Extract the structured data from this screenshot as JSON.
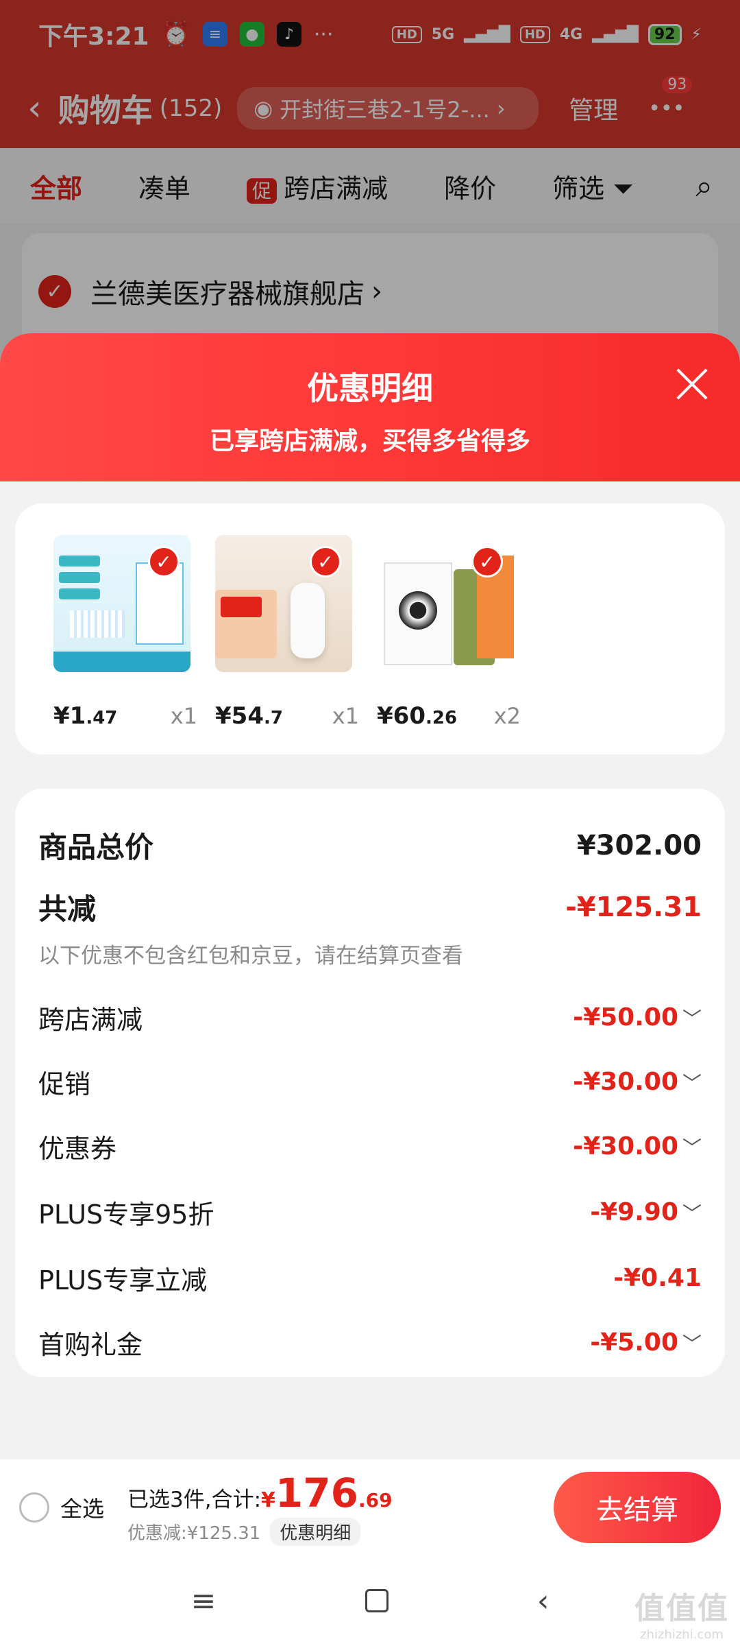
{
  "status_bar": {
    "time": "下午3:21",
    "signal_5g": "5G",
    "signal_4g": "4G",
    "hd": "HD",
    "battery": "92"
  },
  "header": {
    "back_icon": "chevron-left-icon",
    "title": "购物车",
    "count": "(152)",
    "address": "开封街三巷2-1号2-...",
    "manage": "管理",
    "more_badge": "93"
  },
  "filters": {
    "all": "全部",
    "bundle": "凑单",
    "promo_tag": "促",
    "cross_store": "跨店满减",
    "price_drop": "降价",
    "filter": "筛选"
  },
  "store": {
    "name": "兰德美医疗器械旗舰店"
  },
  "sheet": {
    "title": "优惠明细",
    "subtitle": "已享跨店满减，买得多省得多",
    "products": [
      {
        "price_int": "¥1",
        "price_dec": ".47",
        "qty": "x1"
      },
      {
        "price_int": "¥54",
        "price_dec": ".7",
        "qty": "x1"
      },
      {
        "price_int": "¥60",
        "price_dec": ".26",
        "qty": "x2"
      }
    ],
    "summary": {
      "total_label": "商品总价",
      "total_value": "¥302.00",
      "reduce_label": "共减",
      "reduce_value": "-¥125.31",
      "note": "以下优惠不包含红包和京豆，请在结算页查看",
      "items": [
        {
          "label": "跨店满减",
          "value": "-¥50.00"
        },
        {
          "label": "促销",
          "value": "-¥30.00"
        },
        {
          "label": "优惠券",
          "value": "-¥30.00"
        },
        {
          "label": "PLUS专享95折",
          "value": "-¥9.90"
        },
        {
          "label": "PLUS专享立减",
          "value": "-¥0.41"
        },
        {
          "label": "首购礼金",
          "value": "-¥5.00"
        }
      ]
    }
  },
  "checkout": {
    "select_all": "全选",
    "selected_label": "已选3件,合计:",
    "currency": "¥",
    "total_int": "176",
    "total_dec": ".69",
    "discount_text": "优惠减:¥125.31",
    "detail_button": "优惠明细",
    "checkout_button": "去结算"
  },
  "watermark": {
    "logo": "值值值",
    "text": "zhizhizhi.com"
  },
  "colors": {
    "brand_red": "#e2231a",
    "header_red": "#d8382e"
  }
}
